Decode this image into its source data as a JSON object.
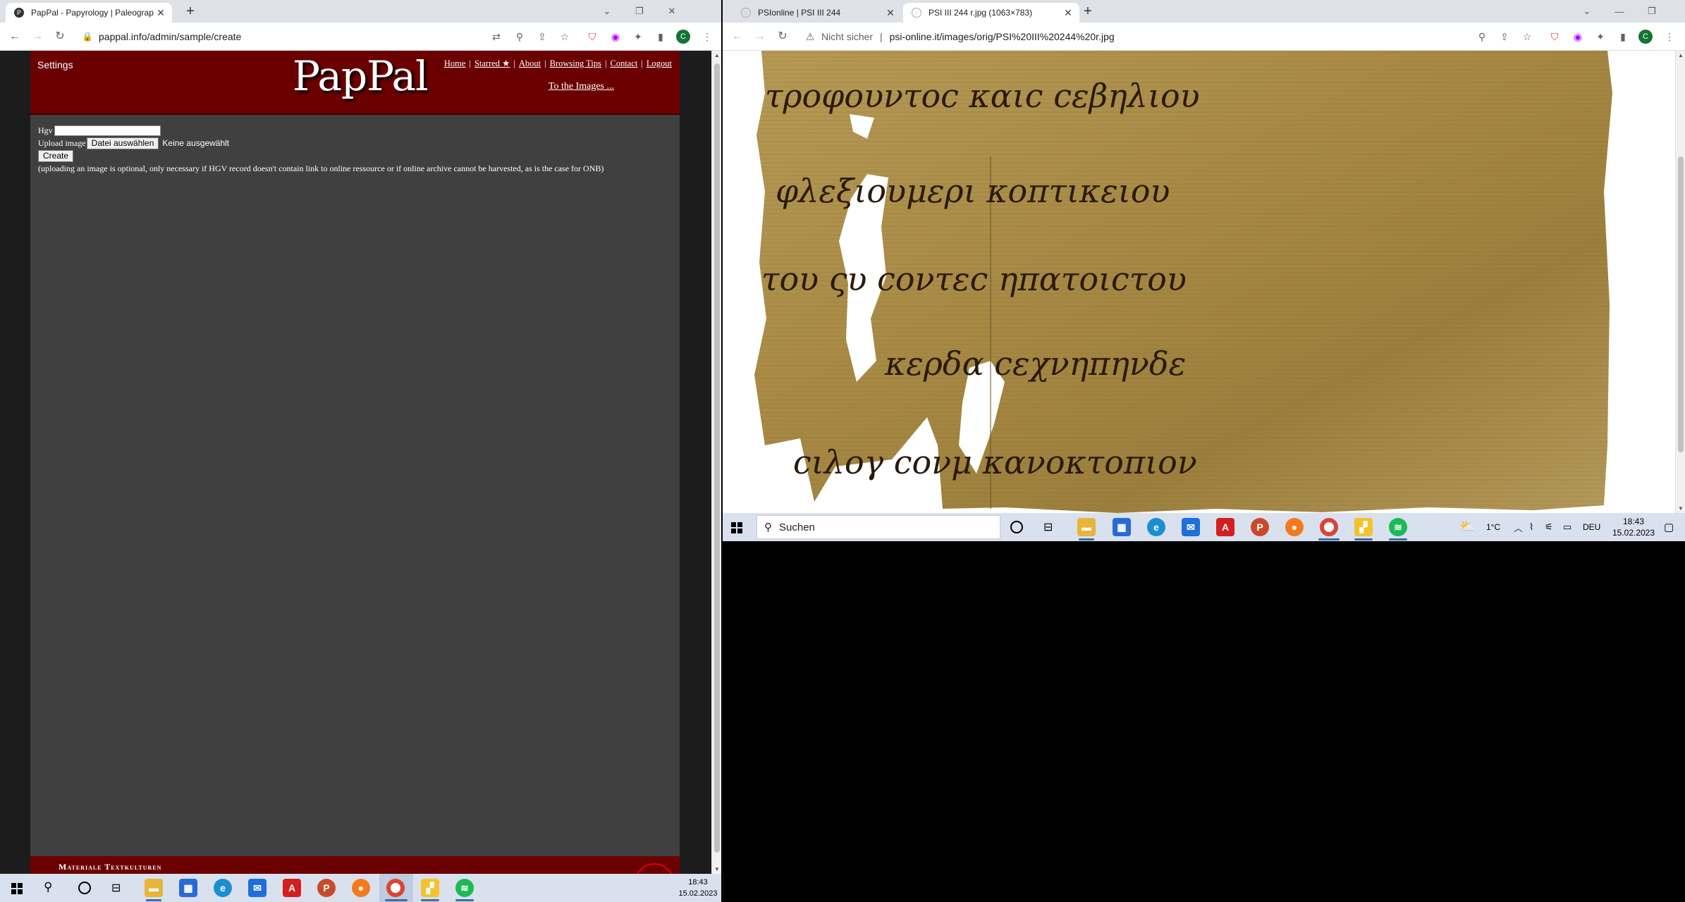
{
  "left_browser": {
    "tabs": [
      {
        "title": "PapPal - Papyrology | Paleography",
        "active": true
      },
      {
        "title": "",
        "active": false
      }
    ],
    "url": "pappal.info/admin/sample/create",
    "profile_initial": "C"
  },
  "pappal": {
    "settings": "Settings",
    "logo": "PapPal",
    "nav": [
      "Home",
      "Starred ★",
      "About",
      "Browsing Tips",
      "Contact",
      "Logout"
    ],
    "to_images": "To the Images ...",
    "form": {
      "hgv_label": "Hgv",
      "hgv_value": "",
      "upload_label": "Upload image",
      "file_button": "Datei auswählen",
      "file_status": "Keine ausgewählt",
      "create_button": "Create",
      "note": "(uploading an image is optional, only necessary if HGV record doesn't contain link to online ressource or if online archive cannot be harvested, as is the case for ONB)"
    },
    "footer": "Materiale Textkulturen",
    "colors": {
      "header": "#6b0000",
      "page": "#404040"
    }
  },
  "right_browser": {
    "tabs": [
      {
        "title": "PSIonline | PSI III 244",
        "active": false
      },
      {
        "title": "PSI III 244 r.jpg (1063×783)",
        "active": true
      }
    ],
    "security": "Nicht sicher",
    "url": "psi-online.it/images/orig/PSI%20III%20244%20r.jpg",
    "profile_initial": "C",
    "image_text_lines": [
      "τροφουντοϲ καιϲ ϲεβηλιου",
      "φλεξιουμερι κοπτικειου",
      "του ςυ ϲοντεϲ ηπατοιϲτου",
      "κερδα ϲεχνηπηνδε",
      "ϲιλογ ϲονμ κανοκτοπιον"
    ]
  },
  "taskbar_small": {
    "search": "Suchen",
    "weather": "1°C",
    "lang": "DEU",
    "time": "18:43",
    "date": "15.02.2023"
  },
  "taskbar_large": {
    "time": "18:43",
    "date": "15.02.2023"
  }
}
